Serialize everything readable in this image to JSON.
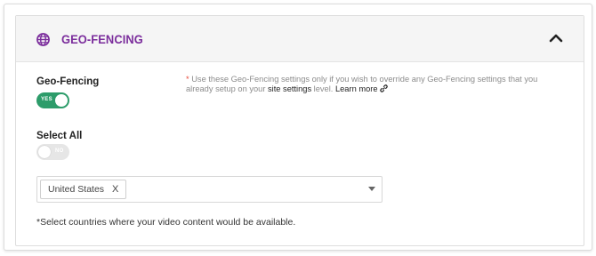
{
  "panel": {
    "title": "GEO-FENCING",
    "title_color": "#7b2d9c"
  },
  "geo_fencing": {
    "label": "Geo-Fencing",
    "toggle_text": "YES",
    "toggle_on": true
  },
  "note": {
    "star": "*",
    "text_before": " Use these Geo-Fencing settings only if you wish to override any Geo-Fencing settings that you already setup on your ",
    "link_text": "site settings",
    "text_mid": " level. ",
    "learn_more": "Learn more"
  },
  "select_all": {
    "label": "Select All",
    "toggle_text": "NO",
    "toggle_on": false
  },
  "countries": {
    "selected": [
      "United States"
    ],
    "remove_symbol": "X"
  },
  "help_text": "*Select countries where your video content would be available.",
  "colors": {
    "accent": "#7b2d9c",
    "toggle_on": "#2d9c6a",
    "required": "#e84a3c"
  },
  "icons": {
    "header": "globe-icon",
    "collapse": "chevron-up-icon",
    "learn_more": "link-icon",
    "select": "caret-down-icon"
  }
}
